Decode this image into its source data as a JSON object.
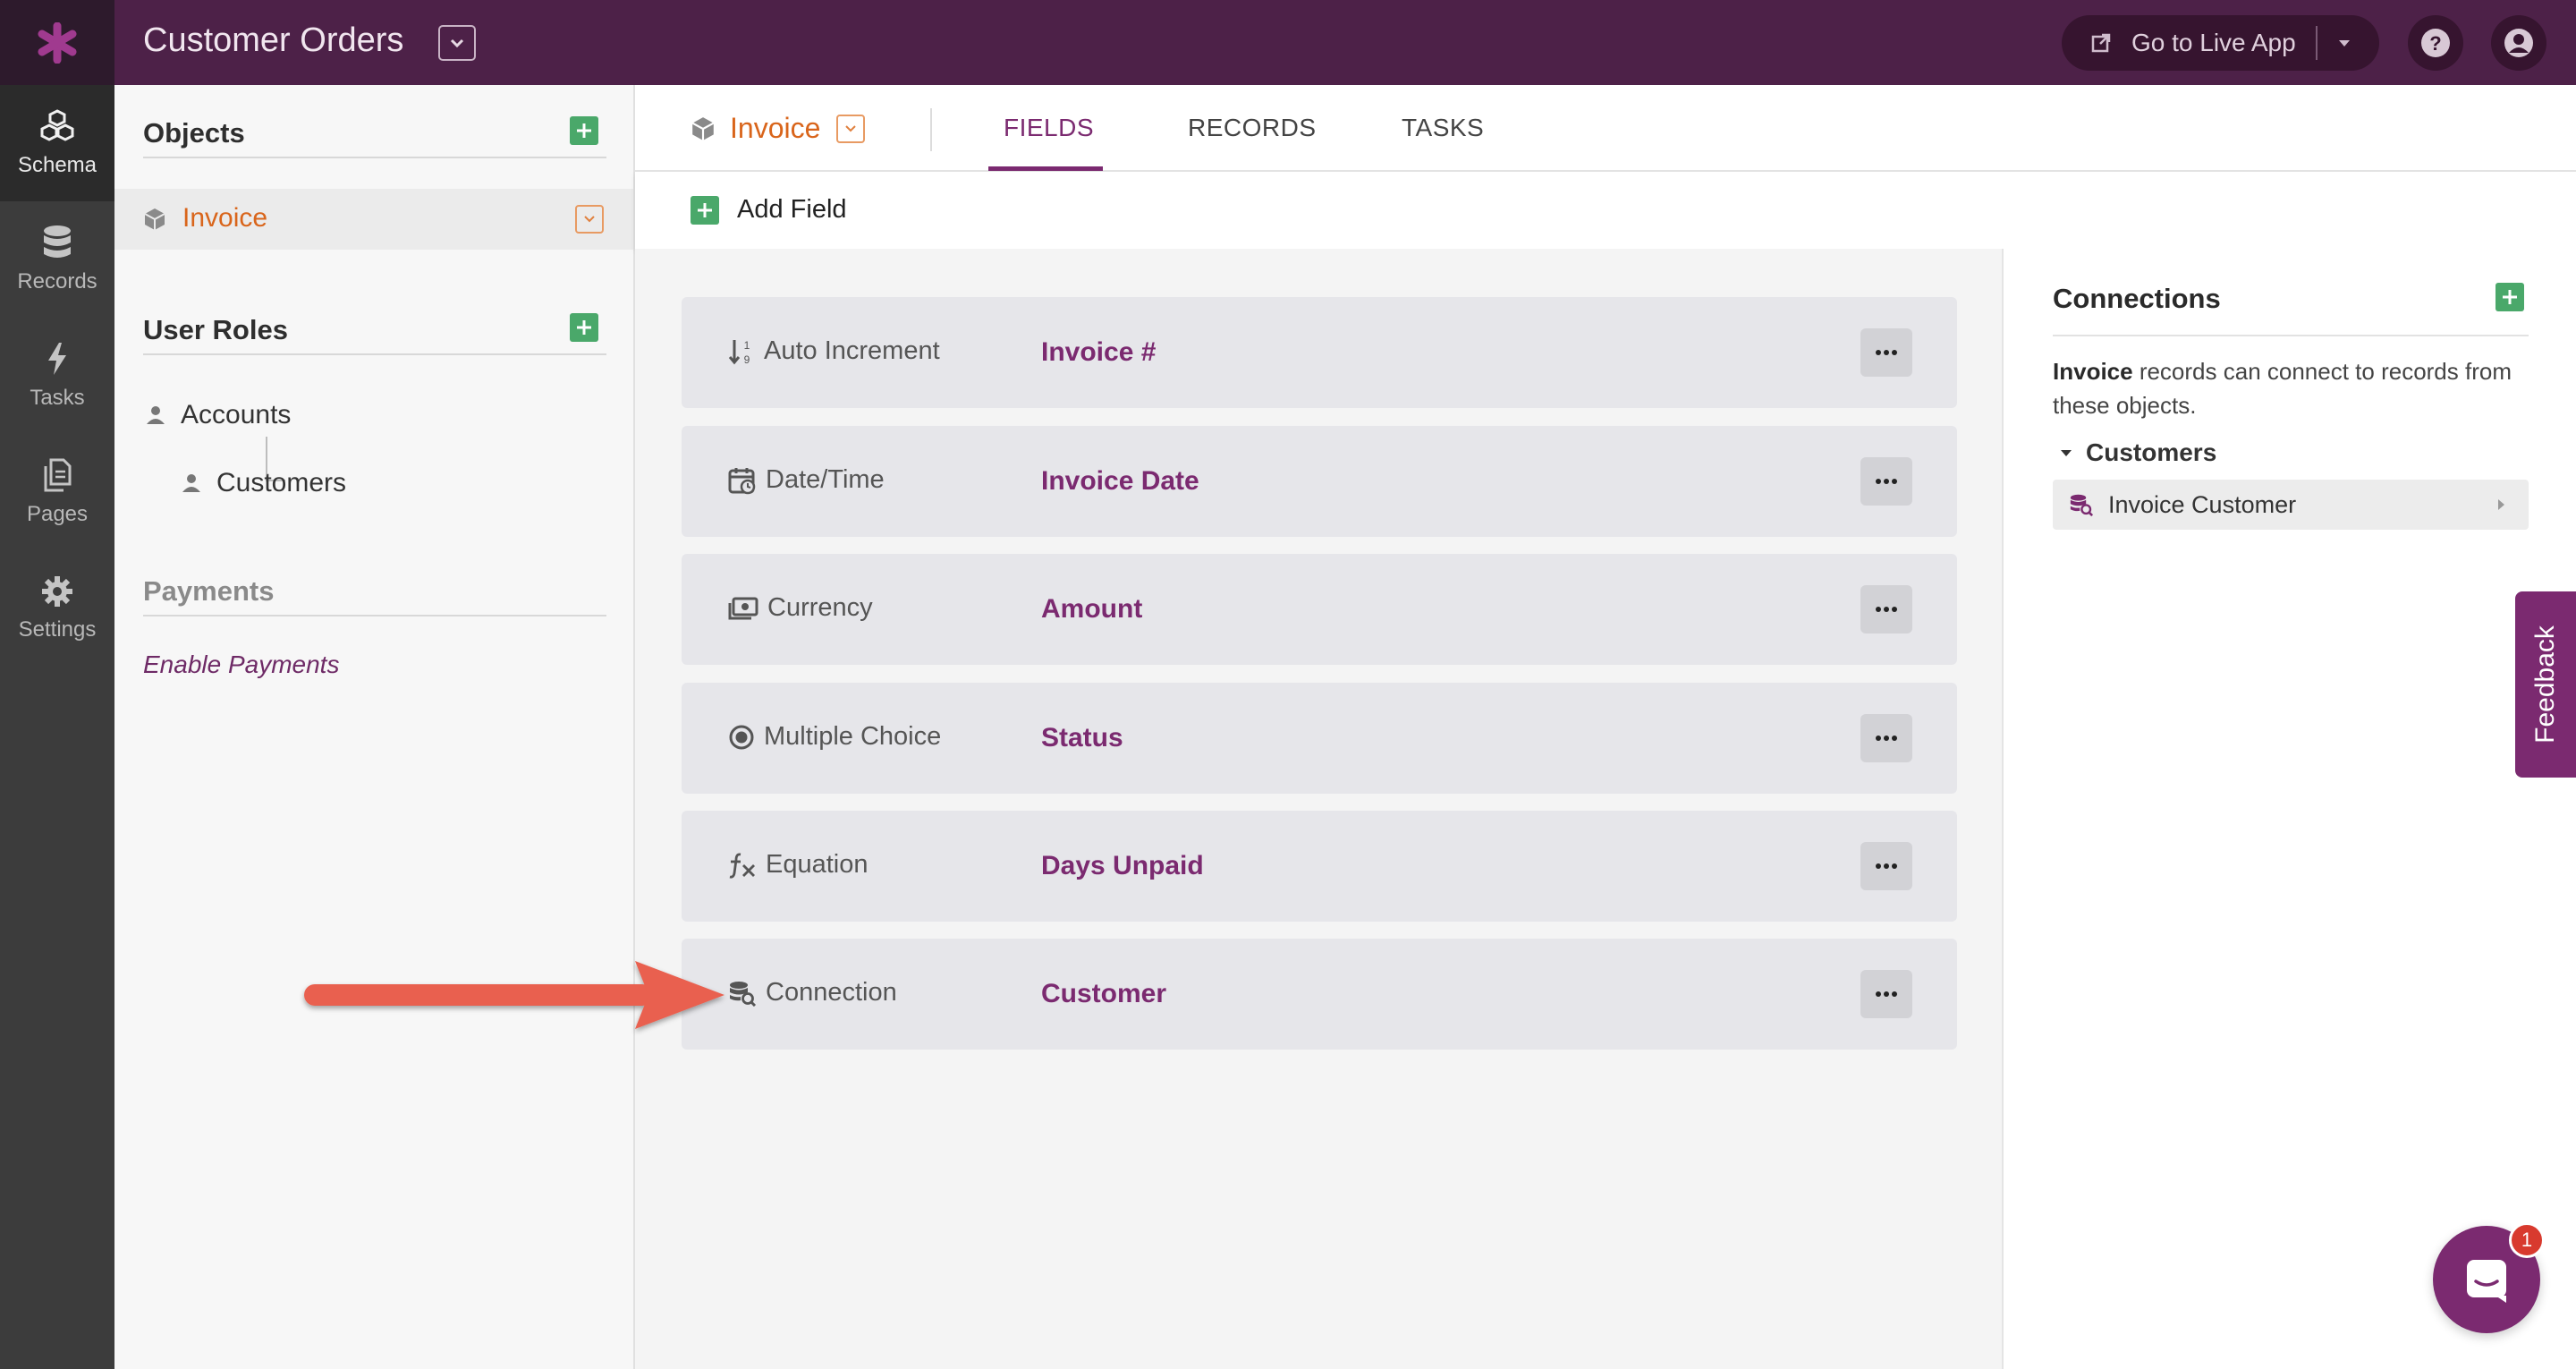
{
  "app": {
    "title": "Customer Orders"
  },
  "topbar": {
    "live_app_label": "Go to Live App"
  },
  "rail": [
    {
      "label": "Schema",
      "icon": "schema-icon",
      "active": true
    },
    {
      "label": "Records",
      "icon": "database-icon"
    },
    {
      "label": "Tasks",
      "icon": "bolt-icon"
    },
    {
      "label": "Pages",
      "icon": "pages-icon"
    },
    {
      "label": "Settings",
      "icon": "gear-icon"
    }
  ],
  "sidebar": {
    "objects_title": "Objects",
    "objects": [
      {
        "label": "Invoice",
        "icon": "cube-icon"
      }
    ],
    "user_roles_title": "User Roles",
    "roles": [
      {
        "label": "Accounts"
      },
      {
        "label": "Customers"
      }
    ],
    "payments_title": "Payments",
    "enable_payments": "Enable Payments"
  },
  "main": {
    "object_name": "Invoice",
    "tabs": [
      {
        "label": "FIELDS",
        "active": true
      },
      {
        "label": "RECORDS"
      },
      {
        "label": "TASKS"
      }
    ],
    "add_field_label": "Add Field",
    "fields": [
      {
        "type": "Auto Increment",
        "name": "Invoice #",
        "icon": "auto-increment-icon"
      },
      {
        "type": "Date/Time",
        "name": "Invoice Date",
        "icon": "calendar-icon"
      },
      {
        "type": "Currency",
        "name": "Amount",
        "icon": "currency-icon"
      },
      {
        "type": "Multiple Choice",
        "name": "Status",
        "icon": "radio-icon"
      },
      {
        "type": "Equation",
        "name": "Days Unpaid",
        "icon": "function-icon"
      },
      {
        "type": "Connection",
        "name": "Customer",
        "icon": "connection-icon"
      }
    ]
  },
  "connections": {
    "title": "Connections",
    "desc_bold": "Invoice",
    "desc_rest": " records can connect to records from these objects.",
    "group": "Customers",
    "items": [
      {
        "label": "Invoice Customer"
      }
    ]
  },
  "feedback_label": "Feedback",
  "chat": {
    "badge": "1"
  },
  "colors": {
    "brand": "#4d2148",
    "accent": "#7b2a70",
    "object": "#d9651b",
    "add": "#4aa86a",
    "arrow": "#e9604f"
  }
}
